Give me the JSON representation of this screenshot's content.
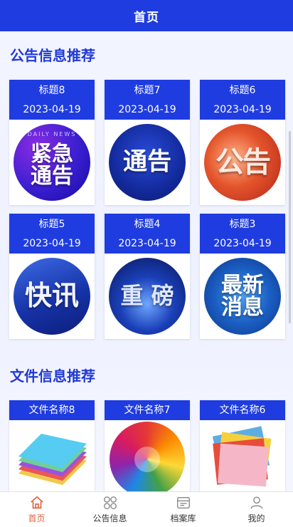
{
  "header": {
    "title": "首页"
  },
  "notices": {
    "section_title": "公告信息推荐",
    "items": [
      {
        "title": "标题8",
        "date": "2023-04-19",
        "image_text": "紧急\n通告",
        "image_caption": "DAILY NEWS",
        "image_icon": "urgent-notice-image"
      },
      {
        "title": "标题7",
        "date": "2023-04-19",
        "image_text": "通告",
        "image_icon": "notice-image"
      },
      {
        "title": "标题6",
        "date": "2023-04-19",
        "image_text": "公告",
        "image_icon": "announcement-image"
      },
      {
        "title": "标题5",
        "date": "2023-04-19",
        "image_text": "快讯",
        "image_icon": "flash-news-image"
      },
      {
        "title": "标题4",
        "date": "2023-04-19",
        "image_text": "重 磅",
        "image_icon": "headline-image"
      },
      {
        "title": "标题3",
        "date": "2023-04-19",
        "image_text": "最新\n消息",
        "image_icon": "latest-news-image"
      }
    ]
  },
  "files": {
    "section_title": "文件信息推荐",
    "items": [
      {
        "title": "文件名称8",
        "image_icon": "paper-stack-image"
      },
      {
        "title": "文件名称7",
        "image_icon": "color-folders-image"
      },
      {
        "title": "文件名称6",
        "image_icon": "color-papers-image"
      }
    ]
  },
  "tabbar": {
    "items": [
      {
        "label": "首页",
        "icon": "home-icon",
        "active": true
      },
      {
        "label": "公告信息",
        "icon": "grid-icon",
        "active": false
      },
      {
        "label": "档案库",
        "icon": "archive-icon",
        "active": false
      },
      {
        "label": "我的",
        "icon": "user-icon",
        "active": false
      }
    ]
  },
  "colors": {
    "primary": "#1f3ce0",
    "active_tab": "#e0623e",
    "section_title": "#2139d6"
  }
}
